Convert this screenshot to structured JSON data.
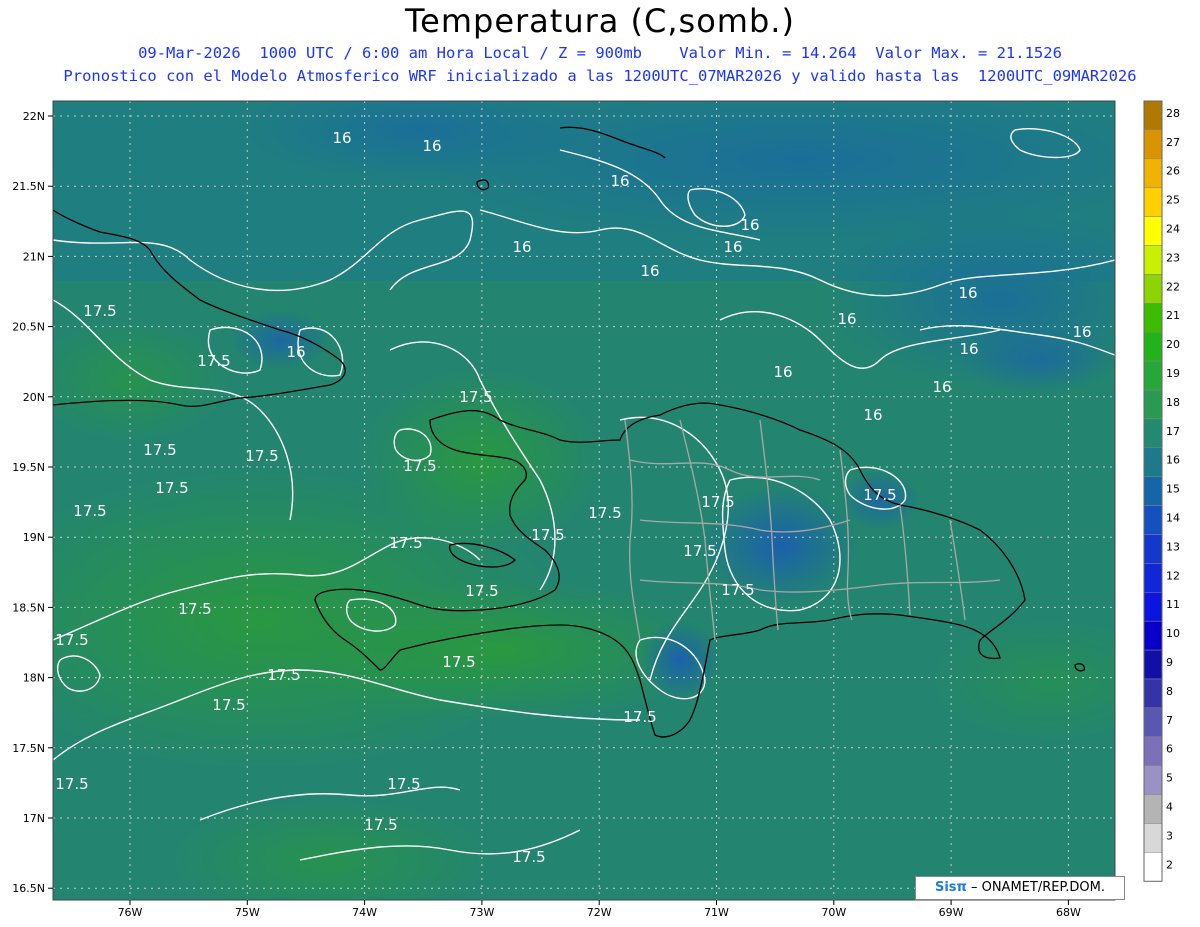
{
  "header": {
    "title": "Temperatura (C,somb.)",
    "line1": "09-Mar-2026  1000 UTC / 6:00 am Hora Local / Z = 900mb    Valor Min. = 14.264  Valor Max. = 21.1526",
    "line2": "Pronostico con el Modelo Atmosferico WRF inicializado a las 1200UTC_07MAR2026 y valido hasta las  1200UTC_09MAR2026"
  },
  "axes": {
    "lat_labels": [
      "22N",
      "21.5N",
      "21N",
      "20.5N",
      "20N",
      "19.5N",
      "19N",
      "18.5N",
      "18N",
      "17.5N",
      "17N",
      "16.5N"
    ],
    "lon_labels": [
      "76W",
      "75W",
      "74W",
      "73W",
      "72W",
      "71W",
      "70W",
      "69W",
      "68W"
    ]
  },
  "colorbar": {
    "values": [
      "28",
      "27",
      "26",
      "25",
      "24",
      "23",
      "22",
      "21",
      "20",
      "19",
      "18",
      "17",
      "16",
      "15",
      "14",
      "13",
      "12",
      "11",
      "10",
      "9",
      "8",
      "7",
      "6",
      "5",
      "4",
      "3",
      "2"
    ],
    "colors": [
      "#b07a00",
      "#d99400",
      "#f0b400",
      "#ffd000",
      "#ffff00",
      "#c8f000",
      "#8ed400",
      "#3cbd00",
      "#22b21a",
      "#27a63a",
      "#2a9a52",
      "#228a70",
      "#1c7a8c",
      "#1566a8",
      "#1450c0",
      "#1238cc",
      "#1026d8",
      "#0c14e0",
      "#0800c8",
      "#1010a8",
      "#3434a8",
      "#5858b0",
      "#7c70b8",
      "#9a92c4",
      "#b4b4b4",
      "#d8d8d8",
      "#ffffff"
    ]
  },
  "contour_labels": [
    "16",
    "16",
    "16",
    "16",
    "16",
    "16",
    "16",
    "16",
    "16",
    "16",
    "16",
    "16",
    "16",
    "16",
    "16",
    "17.5",
    "17.5",
    "17.5",
    "17.5",
    "17.5",
    "17.5",
    "17.5",
    "17.5",
    "17.5",
    "17.5",
    "17.5",
    "17.5",
    "17.5",
    "17.5",
    "17.5",
    "17.5",
    "17.5",
    "17.5",
    "17.5",
    "17.5",
    "17.5",
    "17.5",
    "17.5",
    "17.5",
    "17.5",
    "17.5"
  ],
  "credit": {
    "logo": "Sisπ",
    "text": "– ONAMET/REP.DOM."
  }
}
